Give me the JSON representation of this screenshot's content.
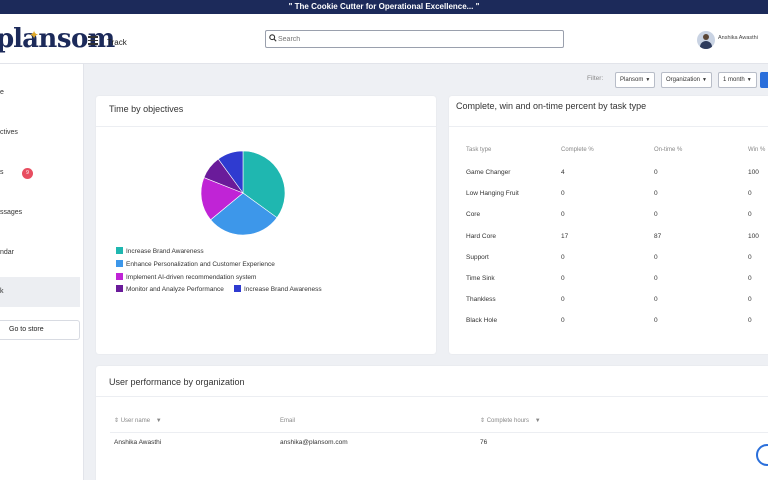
{
  "banner": {
    "text": "\" The Cookie Cutter for Operational Excellence... \""
  },
  "header": {
    "logo_text": "ansom",
    "page_title": "Track",
    "search_placeholder": "Search",
    "user_name": "Anshika Awasthi"
  },
  "sidebar": {
    "items": [
      {
        "label": "e"
      },
      {
        "label": "ctives"
      },
      {
        "label": "s",
        "badge": "9"
      },
      {
        "label": "ssages"
      },
      {
        "label": "ndar"
      },
      {
        "label": "k"
      }
    ],
    "store_button": "Go to store"
  },
  "filters": {
    "label": "Filter:",
    "dropdowns": [
      "Plansom",
      "Organization",
      "1 month"
    ]
  },
  "objectives_card": {
    "title": "Time by objectives",
    "legend": [
      {
        "label": "Increase Brand Awareness",
        "color": "#1fb7b0"
      },
      {
        "label": "Enhance Personalization and Customer Experience",
        "color": "#3d97ea"
      },
      {
        "label": "Implement AI-driven recommendation system",
        "color": "#c024d6"
      },
      {
        "label": "Monitor and Analyze Performance",
        "color": "#6a1b9a"
      },
      {
        "label": "Increase Brand Awareness",
        "color": "#2f3bd0"
      }
    ],
    "pie_shares": [
      0.35,
      0.29,
      0.17,
      0.09,
      0.1
    ]
  },
  "task_card": {
    "title": "Complete, win and on-time percent by task type",
    "headers": [
      "Task type",
      "Complete %",
      "On-time %",
      "Win %"
    ],
    "rows": [
      [
        "Game Changer",
        "4",
        "0",
        "100"
      ],
      [
        "Low Hanging Fruit",
        "0",
        "0",
        "0"
      ],
      [
        "Core",
        "0",
        "0",
        "0"
      ],
      [
        "Hard Core",
        "17",
        "87",
        "100"
      ],
      [
        "Support",
        "0",
        "0",
        "0"
      ],
      [
        "Time Sink",
        "0",
        "0",
        "0"
      ],
      [
        "Thankless",
        "0",
        "0",
        "0"
      ],
      [
        "Black Hole",
        "0",
        "0",
        "0"
      ]
    ]
  },
  "user_card": {
    "title": "User performance by organization",
    "headers": [
      "User name",
      "Email",
      "Complete hours"
    ],
    "rows": [
      [
        "Anshika Awasthi",
        "anshika@plansom.com",
        "76"
      ]
    ]
  }
}
